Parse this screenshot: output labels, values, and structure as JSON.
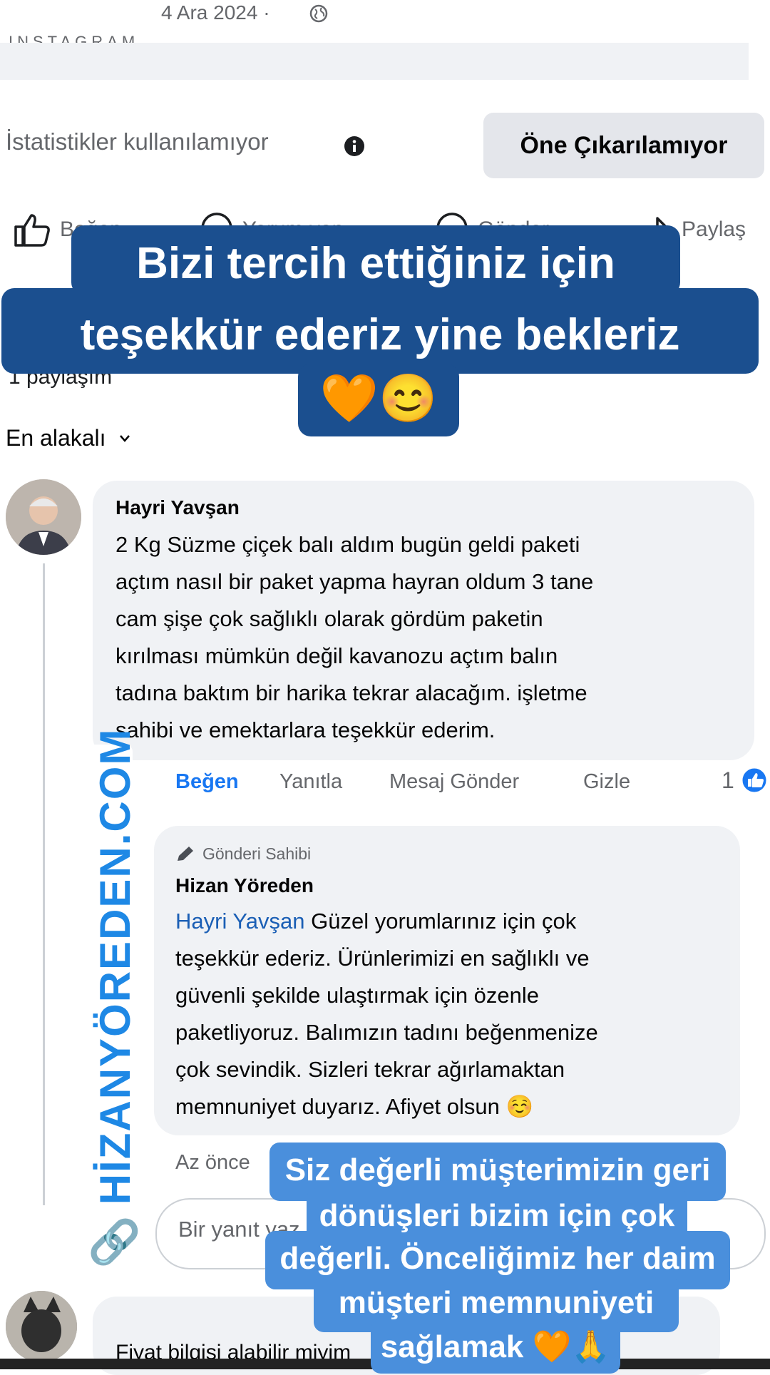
{
  "post": {
    "date": "4 Ara 2024",
    "date_separator": "·",
    "cut_header": "INSTAGRAM",
    "stats_text": "İstatistikler kullanılamıyor",
    "boost_button": "Öne Çıkarılamıyor",
    "actions": {
      "like": "Beğen",
      "comment": "Yorum yap",
      "send": "Gönder",
      "share": "Paylaş"
    },
    "shares_text": "1 paylaşım",
    "sort_label": "En alakalı"
  },
  "overlay_top": {
    "line1": "Bizi tercih ettiğiniz için",
    "line2": "teşekkür ederiz yine bekleriz",
    "emoji": "🧡😊"
  },
  "comment": {
    "author": "Hayri Yavşan",
    "text_lines": [
      "2 Kg Süzme çiçek balı aldım  bugün geldi paketi",
      "açtım nasıl bir paket yapma hayran oldum 3 tane",
      "cam şişe çok sağlıklı olarak gördüm paketin",
      "kırılması mümkün değil kavanozu açtım balın",
      "tadına baktım bir harika tekrar alacağım. işletme",
      "sahibi ve emektarlara teşekkür ederim."
    ],
    "actions": {
      "like": "Beğen",
      "reply": "Yanıtla",
      "message": "Mesaj Gönder",
      "hide": "Gizle"
    },
    "reaction_count": "1"
  },
  "reply": {
    "badge": "Gönderi Sahibi",
    "author": "Hizan Yöreden",
    "mention": "Hayri Yavşan",
    "text_lines": [
      " Güzel yorumlarınız için çok",
      "teşekkür ederiz. Ürünlerimizi en sağlıklı ve",
      "güvenli şekilde ulaştırmak için özenle",
      "paketliyoruz. Balımızın tadını beğenmenize",
      "çok sevindik. Sizleri tekrar ağırlamaktan",
      "memnuniyet duyarız. Afiyet olsun ☺️"
    ],
    "time": "Az önce",
    "input_placeholder": "Bir yanıt yaz"
  },
  "overlay_bottom": {
    "lines": [
      "Siz değerli müşterimizin geri",
      "dönüşleri bizim için çok",
      "değerli. Önceliğimiz her daim",
      "müşteri memnuniyeti",
      "sağlamak 🧡🙏"
    ]
  },
  "watermark": "HİZANYÖREDEN.COM",
  "next_comment_text": "Fiyat bilgisi alabilir miyim",
  "colors": {
    "accent": "#1877f2",
    "overlay_dark": "#1b4f8f",
    "overlay_light": "#4a8fdc",
    "bubble": "#f0f2f5"
  }
}
